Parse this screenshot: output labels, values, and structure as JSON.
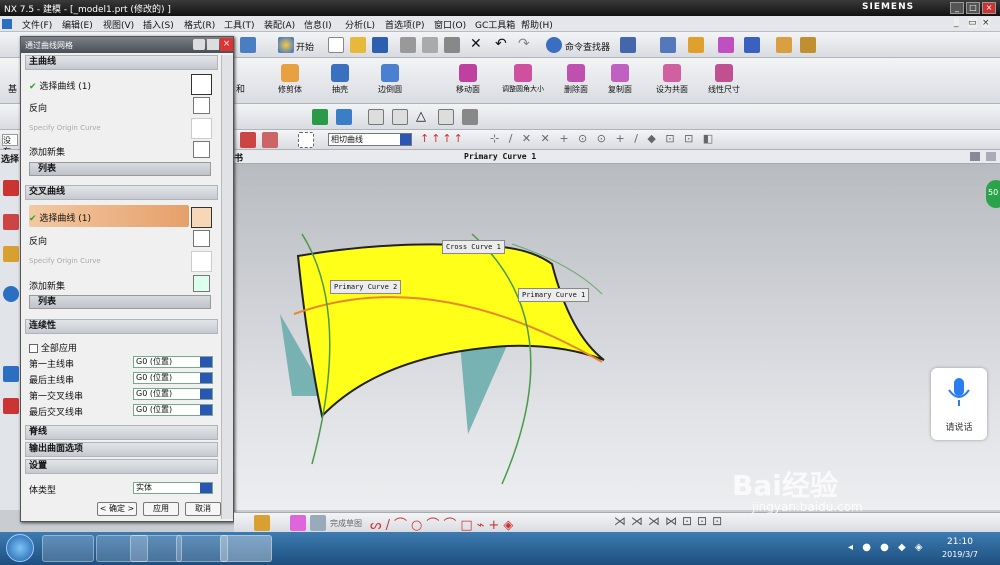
{
  "window": {
    "title": "NX 7.5 - 建模 - [_model1.prt (修改的) ]",
    "brand": "SIEMENS"
  },
  "menu": [
    "文件(F)",
    "编辑(E)",
    "视图(V)",
    "插入(S)",
    "格式(R)",
    "工具(T)",
    "装配(A)",
    "信息(I)",
    "分析(L)",
    "首选项(P)",
    "窗口(O)",
    "GC工具箱",
    "帮助(H)"
  ],
  "toolbar1": {
    "start_label": "开始",
    "command_finder": "命令查找器"
  },
  "toolbar2": {
    "items": [
      "修剪体",
      "抽壳",
      "边倒圆",
      "移动面",
      "调整圆角大小",
      "删除面",
      "复制面",
      "设为共面",
      "线性尺寸"
    ],
    "left_partial": "基",
    "left_partial2": "和"
  },
  "toolbar4": {
    "filter": "相切曲线",
    "side_label": "没有"
  },
  "graphics": {
    "header": "Primary Curve  1",
    "tab_partial": "书"
  },
  "labels": {
    "cross": "Cross Curve  1",
    "primary2": "Primary Curve  2",
    "primary1": "Primary Curve  1"
  },
  "dialog": {
    "title": "通过曲线网格",
    "primary_section": "主曲线",
    "primary_select": "选择曲线 (1)",
    "reverse": "反向",
    "specify_origin": "Specify Origin Curve",
    "add_set": "添加新集",
    "list": "列表",
    "cross_section": "交叉曲线",
    "cross_select": "选择曲线 (1)",
    "cross_reverse": "反向",
    "cross_specify": "Specify Origin Curve",
    "cross_add": "添加新集",
    "cross_list": "列表",
    "continuity": "连续性",
    "apply_all": "全部应用",
    "cont_rows": [
      {
        "label": "第一主线串",
        "value": "G0 (位置)"
      },
      {
        "label": "最后主线串",
        "value": "G0 (位置)"
      },
      {
        "label": "第一交叉线串",
        "value": "G0 (位置)"
      },
      {
        "label": "最后交叉线串",
        "value": "G0 (位置)"
      }
    ],
    "spine": "脊线",
    "output": "输出曲面选项",
    "settings": "设置",
    "body_type_label": "体类型",
    "body_type": "实体",
    "ok": "< 确定 >",
    "apply": "应用",
    "cancel": "取消"
  },
  "left_partial": "选择",
  "left_partial2": "没有",
  "sketch_label": "完成草图",
  "speech": {
    "label": "请说话"
  },
  "watermark": {
    "brand": "Bai经验",
    "url": "jingyan.baidu.com"
  },
  "clock": {
    "time": "21:10",
    "date": "2019/3/7"
  }
}
